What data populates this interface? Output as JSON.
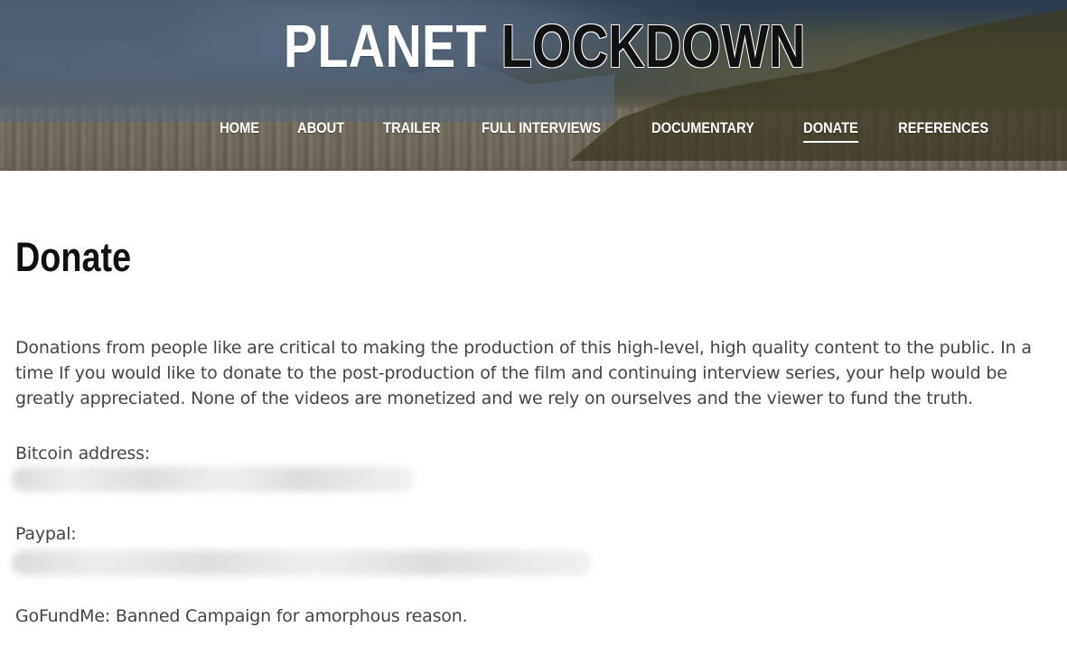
{
  "site": {
    "title_part_1": "PLANET",
    "title_part_2": "LOCKDOWN"
  },
  "nav": {
    "items": [
      {
        "label": "HOME",
        "active": false
      },
      {
        "label": "ABOUT",
        "active": false
      },
      {
        "label": "TRAILER",
        "active": false
      },
      {
        "label": "FULL INTERVIEWS",
        "active": false
      },
      {
        "label": "DOCUMENTARY",
        "active": false
      },
      {
        "label": "DONATE",
        "active": true
      },
      {
        "label": "REFERENCES",
        "active": false
      }
    ]
  },
  "page": {
    "title": "Donate",
    "intro": "Donations from people like are critical to making the production of this high-level, high quality content to the public. In a time If you would like to donate to the post-production of the film and continuing interview series, your help would be greatly appreciated. None of the videos are monetized and we rely on ourselves and the viewer to fund the truth.",
    "bitcoin_label": "Bitcoin address:",
    "paypal_label": "Paypal:",
    "gofundme_text": "GoFundMe: Banned Campaign for amorphous reason."
  },
  "colors": {
    "body_text": "#444444",
    "heading_text": "#111111",
    "nav_text": "#ffffff"
  }
}
